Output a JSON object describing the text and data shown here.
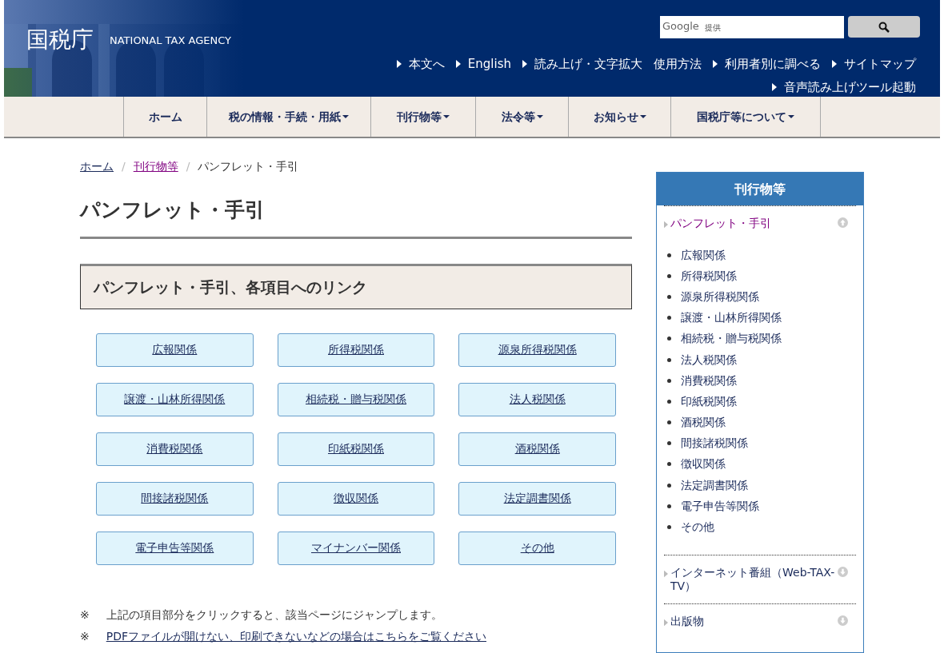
{
  "header": {
    "logo": "国税庁",
    "subtitle": "NATIONAL TAX AGENCY",
    "search": {
      "brand": "Google",
      "placeholder": "提供"
    },
    "links": [
      {
        "label": "本文へ",
        "arrow": true
      },
      {
        "label": "English",
        "arrow": true
      },
      {
        "label": "読み上げ・文字拡大",
        "arrow": true
      },
      {
        "label": "使用方法",
        "arrow": false
      },
      {
        "label": "利用者別に調べる",
        "arrow": true
      },
      {
        "label": "サイトマップ",
        "arrow": true
      }
    ],
    "links_row2": [
      {
        "label": "音声読み上げツール起動",
        "arrow": true
      }
    ]
  },
  "nav": [
    {
      "label": "ホーム",
      "dropdown": false
    },
    {
      "label": "税の情報・手続・用紙",
      "dropdown": true
    },
    {
      "label": "刊行物等",
      "dropdown": true
    },
    {
      "label": "法令等",
      "dropdown": true
    },
    {
      "label": "お知らせ",
      "dropdown": true
    },
    {
      "label": "国税庁等について",
      "dropdown": true
    }
  ],
  "breadcrumb": [
    {
      "label": "ホーム",
      "kind": "link"
    },
    {
      "label": "/",
      "kind": "separator"
    },
    {
      "label": "刊行物等",
      "kind": "visited_link"
    },
    {
      "label": "/",
      "kind": "separator"
    },
    {
      "label": "パンフレット・手引",
      "kind": "current"
    }
  ],
  "page_title": "パンフレット・手引",
  "section_title": "パンフレット・手引、各項目へのリンク",
  "link_buttons": [
    "広報関係",
    "所得税関係",
    "源泉所得税関係",
    "譲渡・山林所得関係",
    "相続税・贈与税関係",
    "法人税関係",
    "消費税関係",
    "印紙税関係",
    "酒税関係",
    "間接諸税関係",
    "徴収関係",
    "法定調書関係",
    "電子申告等関係",
    "マイナンバー関係",
    "その他"
  ],
  "notes": [
    {
      "mark": "※",
      "text": "上記の項目部分をクリックすると、該当ページにジャンプします。",
      "kind": "text"
    },
    {
      "mark": "※",
      "text": "PDFファイルが開けない、印刷できないなどの場合はこちらをご覧ください",
      "kind": "link"
    }
  ],
  "sidebar": {
    "title": "刊行物等",
    "sections": [
      {
        "label": "パンフレット・手引",
        "expanded": true,
        "selected": true,
        "items": [
          "広報関係",
          "所得税関係",
          "源泉所得税関係",
          "譲渡・山林所得関係",
          "相続税・贈与税関係",
          "法人税関係",
          "消費税関係",
          "印紙税関係",
          "酒税関係",
          "間接諸税関係",
          "徴収関係",
          "法定調書関係",
          "電子申告等関係",
          "その他"
        ]
      },
      {
        "label": "インターネット番組（Web-TAX-TV）",
        "expanded": false,
        "selected": false
      },
      {
        "label": "出版物",
        "expanded": false,
        "selected": false
      }
    ]
  }
}
